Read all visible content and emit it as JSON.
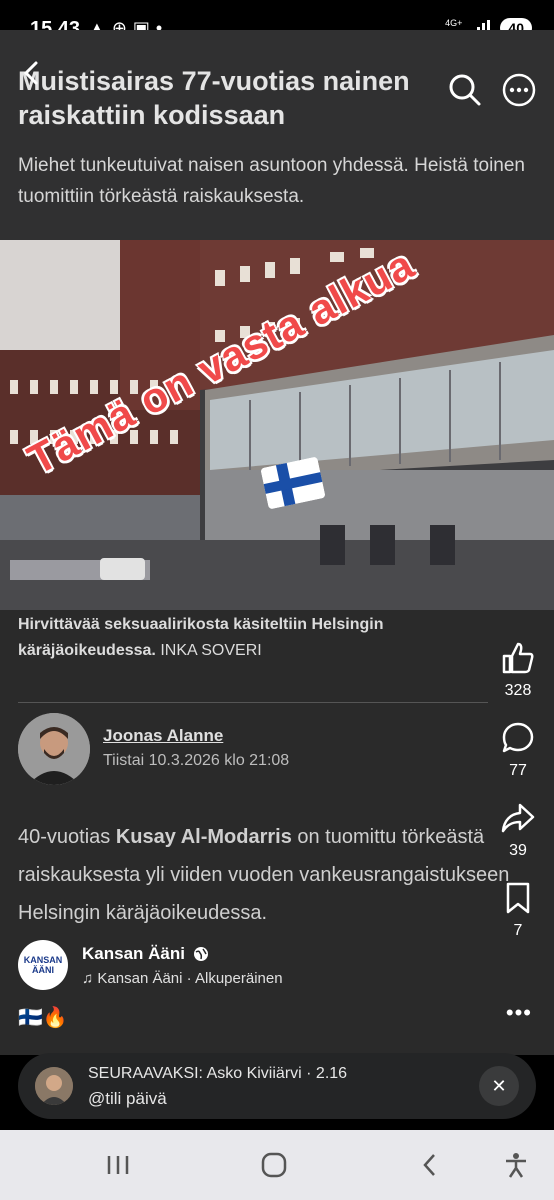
{
  "status": {
    "time": "15.43",
    "left_icons": "▲⊕▣•",
    "network": "4G+",
    "battery": "40"
  },
  "article": {
    "headline": "Muistisairas 77-vuotias nainen raiskattiin kodissaan",
    "lead": "Miehet tunkeutuivat naisen asuntoon yhdessä. Heistä toinen tuomittiin törkeästä raiskauksesta.",
    "overlay_text": "Tämä on vasta alkua",
    "caption_main": "Hirvittävää seksuaalirikosta käsiteltiin Helsingin käräjäoikeudessa.",
    "caption_credit": "INKA SOVERI",
    "author_name": "Joonas Alanne",
    "author_date": "Tiistai 10.3.2026 klo 21:08",
    "body_prefix": "40-vuotias ",
    "body_bold": "Kusay Al-Modarris",
    "body_rest": " on tuomittu törkeästä raiskauksesta yli viiden vuoden vankeusrangaistukseen Helsingin käräjäoikeudessa."
  },
  "actions": {
    "likes": "328",
    "comments": "77",
    "shares": "39",
    "saves": "7"
  },
  "page": {
    "name": "Kansan Ääni",
    "avatar_line1": "KANSAN",
    "avatar_line2": "ÄÄNI",
    "audio": "Kansan Ääni · Alkuperäinen",
    "emojis": "🇫🇮🔥"
  },
  "next": {
    "title": "SEURAAVAKSI: Asko Kiviiärvi · 2.16",
    "subtitle": "@tili päivä"
  },
  "colors": {
    "overlay_red": "#f04a4a",
    "nav_bg": "#e8e8ec"
  }
}
